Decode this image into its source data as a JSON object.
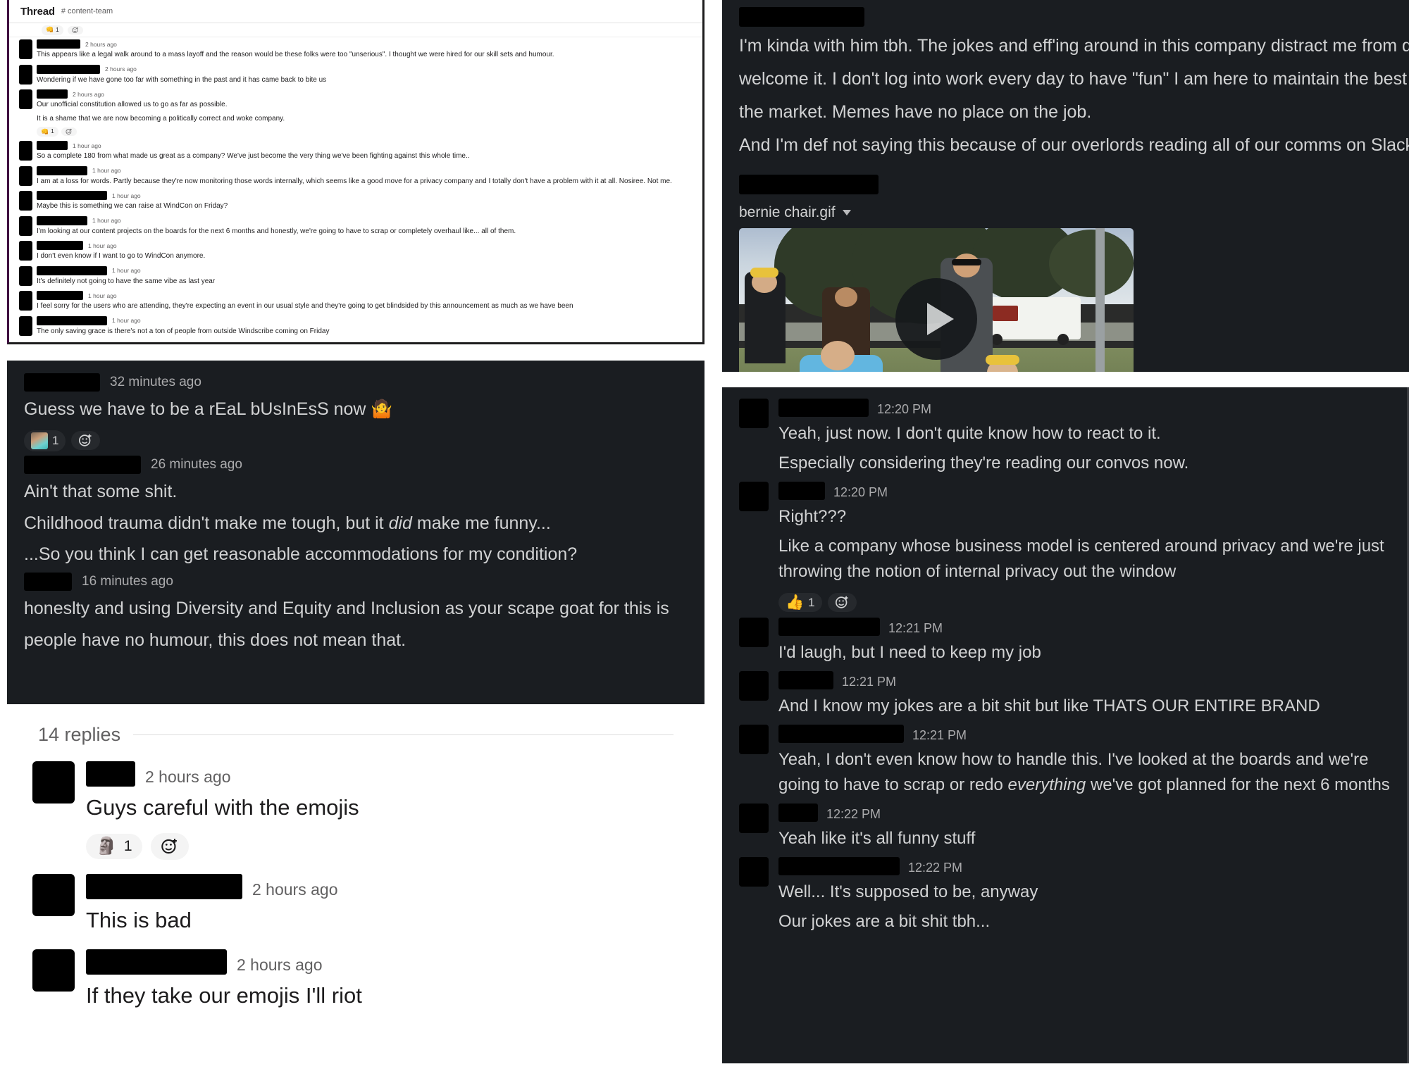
{
  "thread_panel": {
    "header": {
      "title": "Thread",
      "channel": "# content-team"
    },
    "messages": [
      {
        "name_width": 62,
        "timestamp": "2 hours ago",
        "lines": [
          "This appears like a legal walk around to a mass layoff and the reason would be these folks were too \"unserious\". I thought we were hired for our skill sets and humour."
        ]
      },
      {
        "name_width": 90,
        "timestamp": "2 hours ago",
        "lines": [
          "Wondering if we have gone too far with something in the past and it has came back to bite us"
        ]
      },
      {
        "name_width": 44,
        "timestamp": "2 hours ago",
        "lines": [
          "Our unofficial constitution allowed us to go as far as possible.",
          "It is a shame that we are now becoming a politically correct and woke company."
        ],
        "reactions": [
          {
            "emoji": "👊",
            "count": "1"
          }
        ]
      },
      {
        "name_width": 44,
        "timestamp": "1 hour ago",
        "lines": [
          "So a complete 180 from what made us great as a company? We've just become the very thing we've been fighting against this whole time.."
        ]
      },
      {
        "name_width": 72,
        "timestamp": "1 hour ago",
        "lines": [
          "I am at a loss for words. Partly because they're now monitoring those words internally, which seems like a good move for a privacy company and I totally don't have a problem with it at all. Nosiree. Not me."
        ]
      },
      {
        "name_width": 100,
        "timestamp": "1 hour ago",
        "lines": [
          "Maybe this is something we can raise at WindCon on Friday?"
        ]
      },
      {
        "name_width": 72,
        "timestamp": "1 hour ago",
        "lines": [
          "I'm looking at our content projects on the boards for the next 6 months and honestly, we're going to have to scrap or completely overhaul like... all of them."
        ]
      },
      {
        "name_width": 66,
        "timestamp": "1 hour ago",
        "lines": [
          "I don't even know if I want to go to WindCon anymore."
        ]
      },
      {
        "name_width": 100,
        "timestamp": "1 hour ago",
        "lines": [
          "It's definitely not going to have the same vibe as last year"
        ]
      },
      {
        "name_width": 66,
        "timestamp": "1 hour ago",
        "lines": [
          "I feel sorry for the users who are attending, they're expecting an event in our usual style and they're going to get blindsided by this announcement as much as we have been"
        ]
      },
      {
        "name_width": 100,
        "timestamp": "1 hour ago",
        "lines": [
          "The only saving grace is there's not a ton of people from outside Windscribe coming on Friday"
        ]
      }
    ]
  },
  "dark_panel_left": {
    "messages": [
      {
        "name_width": 108,
        "timestamp": "32 minutes ago",
        "lines": [
          "Guess we have to be a rEaL bUsInEsS now 🤷"
        ],
        "reactions": [
          {
            "emoji": "avatar",
            "count": "1"
          }
        ]
      },
      {
        "name_width": 166,
        "timestamp": "26 minutes ago",
        "lines": [
          "Ain't that some shit.",
          "Childhood trauma didn't make me tough, but it <i>did</i> make me funny...",
          "...So you think I can get reasonable accommodations for my condition?"
        ]
      },
      {
        "name_width": 68,
        "timestamp": "16 minutes ago",
        "lines": [
          "honeslty and using Diversity and Equity and Inclusion as your scape goat for this is",
          "people have no humour, this does not mean that."
        ]
      }
    ]
  },
  "replies_panel": {
    "replies_label": "14 replies",
    "items": [
      {
        "name_width": 70,
        "timestamp": "2 hours ago",
        "text": "Guys careful with the emojis",
        "reactions": [
          {
            "emoji": "🗿",
            "count": "1"
          }
        ]
      },
      {
        "name_width": 222,
        "timestamp": "2 hours ago",
        "text": "This is bad",
        "reactions": []
      },
      {
        "name_width": 200,
        "timestamp": "2 hours ago",
        "text": "If they take our emojis I'll riot",
        "reactions": []
      }
    ]
  },
  "dark_panel_top_right": {
    "name_width": 178,
    "paragraphs": [
      "I'm kinda with him tbh. The jokes and eff'ing around in this company distract me from doing my",
      "welcome it. I don't log into work every day to have \"fun\" I am here to maintain the best possibl",
      "the market. Memes have no place on the job."
    ],
    "paragraph2": "And I'm def not saying this because of our overlords reading all of our comms on Slack that's fo",
    "attachment": {
      "filename": "bernie chair.gif",
      "play_label": "play-video"
    },
    "second_name_width": 198
  },
  "dark_panel_bottom_right": {
    "messages": [
      {
        "name_width": 128,
        "timestamp": "12:20 PM",
        "lines": [
          "Yeah, just now. I don't quite know how to react to it."
        ],
        "continuations": [
          "Especially considering they're reading our convos now."
        ]
      },
      {
        "name_width": 66,
        "timestamp": "12:20 PM",
        "lines": [
          "Right???"
        ],
        "continuations": [
          "Like a company whose business model is centered around privacy and we're just throwing the notion of internal privacy out the window"
        ],
        "reactions": [
          {
            "emoji": "👍",
            "count": "1"
          }
        ]
      },
      {
        "name_width": 144,
        "timestamp": "12:21 PM",
        "lines": [
          "I'd laugh, but I need to keep my job"
        ]
      },
      {
        "name_width": 78,
        "timestamp": "12:21 PM",
        "lines": [
          "And I know my jokes are a bit shit but like THATS OUR ENTIRE BRAND"
        ]
      },
      {
        "name_width": 178,
        "timestamp": "12:21 PM",
        "lines": [
          "Yeah, I don't even know how to handle this. I've looked at the boards and we're going to have to scrap or redo <i>everything</i> we've got planned for the next 6 months"
        ]
      },
      {
        "name_width": 56,
        "timestamp": "12:22 PM",
        "lines": [
          "Yeah like it's all funny stuff"
        ]
      },
      {
        "name_width": 172,
        "timestamp": "12:22 PM",
        "lines": [
          "Well... It's supposed to be, anyway"
        ],
        "continuations": [
          "Our jokes are a bit shit tbh..."
        ]
      }
    ]
  },
  "colors": {
    "slack_dark_bg": "#1a1d21",
    "slack_light_bg": "#ffffff",
    "text_light": "#1d1c1d",
    "text_dark_mode": "#d1d2d3",
    "meta_light": "#616061",
    "meta_dark": "#ababad",
    "aubergine": "#3f0e40"
  }
}
